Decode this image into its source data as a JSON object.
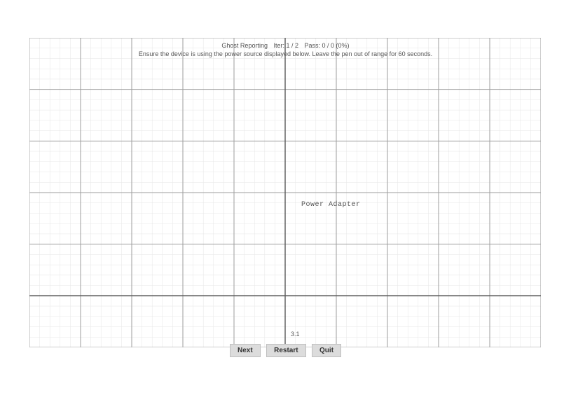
{
  "header": {
    "title": "Ghost Reporting",
    "iter_label": "Iter: 1 / 2",
    "pass_label": "Pass: 0 / 0 (0%)",
    "instruction": "Ensure the device is using the power source displayed below. Leave the pen out of range for 60 seconds."
  },
  "power_source": "Power Adapter",
  "large_tick_number": "3.1",
  "buttons": {
    "next": "Next",
    "restart": "Restart",
    "quit": "Quit"
  },
  "grid": {
    "rows_major": 6,
    "cols_major": 10,
    "minor_per_major": 5,
    "heavy_row_index": 4,
    "major_line_color": "#9e9e9e",
    "minor_line_color": "#e6e6e6",
    "heavy_line_color": "#5a5a5a"
  }
}
